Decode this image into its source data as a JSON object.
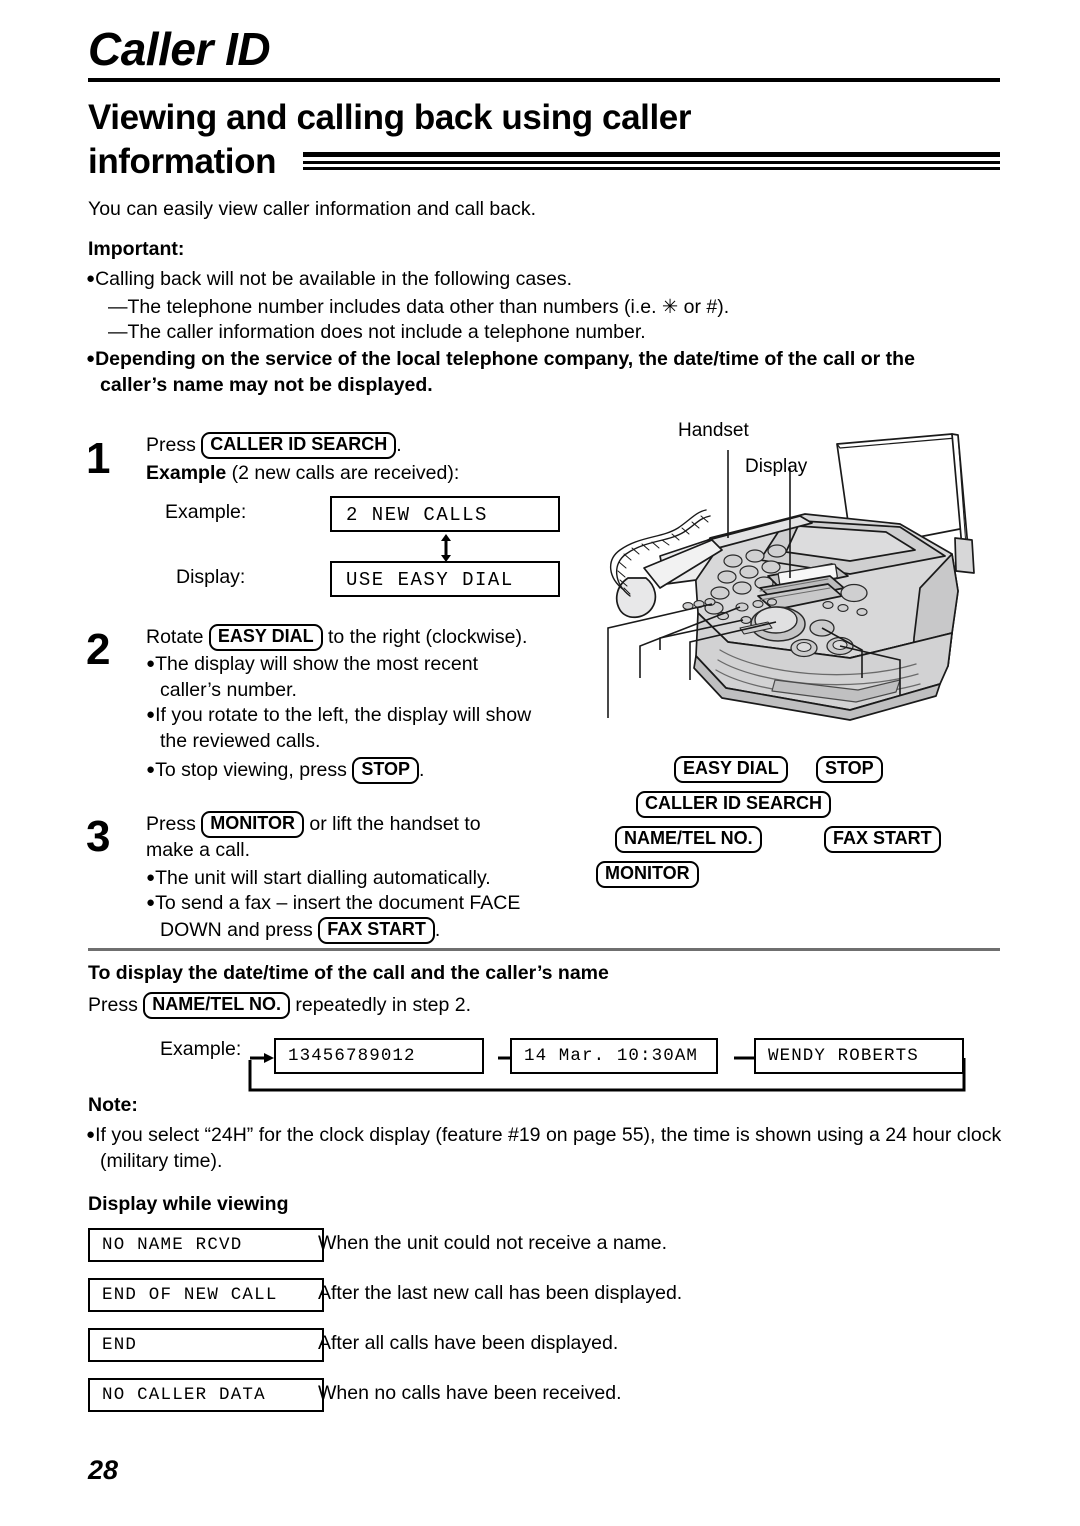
{
  "header": {
    "chapter": "Caller ID",
    "section_line1": "Viewing and calling back using caller",
    "section_line2": "information"
  },
  "intro": "You can easily view caller information and call back.",
  "important": {
    "label": "Important:",
    "bullet1": "Calling back will not be available in the following cases.",
    "dash1": "—The telephone number includes data other than numbers (i.e. ✳ or #).",
    "dash2": "—The caller information does not include a telephone number.",
    "bullet2_line1": "Depending on the service of the local telephone company, the date/time of the call or the",
    "bullet2_line2": "caller’s name may not be displayed."
  },
  "steps": [
    {
      "num": "1",
      "line1_pre": "Press",
      "line1_key": "CALLER ID SEARCH",
      "line1_post": ".",
      "line2_bold": "Example",
      "line2_rest": "(2 new calls are received):",
      "display_rows": [
        {
          "label": "Example:",
          "text": "2 NEW CALLS"
        },
        {
          "label": "Display:",
          "text": "USE EASY DIAL"
        }
      ]
    },
    {
      "num": "2",
      "line1_pre": "Rotate",
      "line1_key": "EASY DIAL",
      "line1_post": "to the right (clockwise).",
      "bullets": [
        "The display will show the most recent",
        "caller’s number.",
        "If you rotate to the left, the display will show",
        "the reviewed calls."
      ],
      "bullet_stop_pre": "To stop viewing, press",
      "bullet_stop_key": "STOP",
      "bullet_stop_post": "."
    },
    {
      "num": "3",
      "line1_pre": "Press",
      "line1_key": "MONITOR",
      "line1_post": "or lift the handset to",
      "line2": "make a call.",
      "bullet1": "The unit will start dialling automatically.",
      "bullet2_line1": "To send a fax – insert the document FACE",
      "bullet2_line2_pre": "DOWN and press",
      "bullet2_key": "FAX START",
      "bullet2_line2_post": "."
    }
  ],
  "illustration": {
    "handset_label": "Handset",
    "display_label": "Display",
    "keys": [
      {
        "name": "easy-dial",
        "label": "EASY DIAL"
      },
      {
        "name": "stop",
        "label": "STOP"
      },
      {
        "name": "caller-id-search",
        "label": "CALLER ID SEARCH"
      },
      {
        "name": "name-tel-no",
        "label": "NAME/TEL NO."
      },
      {
        "name": "fax-start",
        "label": "FAX START"
      },
      {
        "name": "monitor",
        "label": "MONITOR"
      }
    ]
  },
  "datetime_section": {
    "heading": "To display the date/time of the call and the caller’s name",
    "press_pre": "Press",
    "press_key": "NAME/TEL NO.",
    "press_post": "repeatedly in step 2.",
    "example_label": "Example:",
    "flow": [
      "13456789012",
      "14 Mar. 10:30AM",
      "WENDY ROBERTS"
    ]
  },
  "note": {
    "label": "Note:",
    "line1": "If you select “24H” for the clock display (feature #19 on page 55), the time is shown using a 24 hour clock",
    "line2": "(military time)."
  },
  "display_while_viewing": {
    "heading": "Display while viewing",
    "rows": [
      {
        "display": "NO NAME RCVD",
        "desc": "When the unit could not receive a name."
      },
      {
        "display": "END OF NEW CALL",
        "desc": "After the last new call has been displayed."
      },
      {
        "display": "END",
        "desc": "After all calls have been displayed."
      },
      {
        "display": "NO CALLER DATA",
        "desc": "When no calls have been received."
      }
    ]
  },
  "page_number": "28"
}
